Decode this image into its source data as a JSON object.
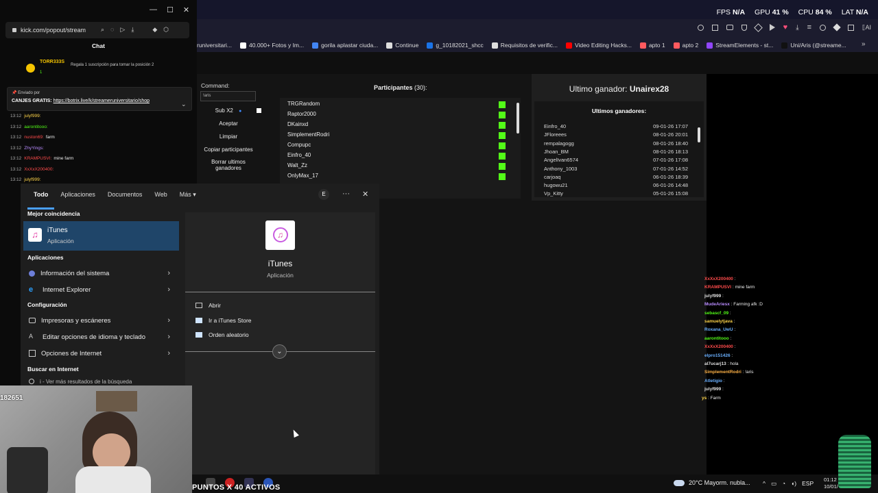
{
  "perf": {
    "fps_label": "FPS",
    "fps": "N/A",
    "gpu_label": "GPU",
    "gpu": "41 %",
    "cpu_label": "CPU",
    "cpu": "84 %",
    "lat_label": "LAT",
    "lat": "N/A"
  },
  "chat_window": {
    "url": "kick.com/popout/stream",
    "title": "Chat",
    "top_user": "TORR333S",
    "top_user_count": "1",
    "sub_prompt": "Regala 1 suscripción para tomar la posición 2",
    "pinned_by": "Enviado por",
    "pinned_text_prefix": "CANJES GRATIS:",
    "pinned_link": "https://botrix.live/k/streameruniversitario/shop"
  },
  "chat_lines": [
    {
      "time": "13:12",
      "user": "julyf999:",
      "msg": ""
    },
    {
      "time": "13:12",
      "user": "aarontitooo:",
      "msg": ""
    },
    {
      "time": "13:12",
      "user": "nuston69:",
      "msg": "farm"
    },
    {
      "time": "13:12",
      "user": "ZhyYings:",
      "msg": ""
    },
    {
      "time": "13:12",
      "user": "KRAMPUSVI:",
      "msg": "mine farm"
    },
    {
      "time": "13:12",
      "user": "XxXxX200400:",
      "msg": ""
    },
    {
      "time": "13:12",
      "user": "julyf999:",
      "msg": ""
    }
  ],
  "bookmarks": [
    {
      "label": "runiversitari...",
      "color": "#444"
    },
    {
      "label": "40.000+ Fotos y Im...",
      "color": "#ffffff"
    },
    {
      "label": "gorila aplastar ciuda...",
      "color": "#4285f4"
    },
    {
      "label": "Continue",
      "color": "#dddddd"
    },
    {
      "label": "g_10182021_shcc",
      "color": "#1a73e8"
    },
    {
      "label": "Requisitos de verific...",
      "color": "#dddddd"
    },
    {
      "label": "Video Editing Hacks...",
      "color": "#ff0000"
    },
    {
      "label": "apto 1",
      "color": "#ff5a5f"
    },
    {
      "label": "apto 2",
      "color": "#ff5a5f"
    },
    {
      "label": "StreamElements - st...",
      "color": "#9146ff"
    },
    {
      "label": "Uni/Aris (@streame...",
      "color": "#111111"
    }
  ],
  "giveaway": {
    "command_label": "Command:",
    "command_value": "!aris",
    "sub_label": "Sub X2",
    "accept": "Aceptar",
    "clear": "Limpiar",
    "copy": "Copiar participantes",
    "delete": "Borrar ultimos ganadores",
    "participants_label": "Participantes",
    "participants_count": "(30):",
    "participants": [
      "TRGRandom",
      "Raptor2000",
      "DKainxd",
      "SimplementRodri",
      "Compupc",
      "Einfro_40",
      "Walt_Zz",
      "OnlyMax_17"
    ],
    "last_winner_label": "Ultimo ganador:",
    "last_winner": "Unairex28",
    "winners_title": "Ultimos ganadores:",
    "winners": [
      {
        "name": "Einfro_40",
        "date": "09-01-26 17:07"
      },
      {
        "name": "JFloreees",
        "date": "08-01-26 20:01"
      },
      {
        "name": "rempalagogg",
        "date": "08-01-26 18:40"
      },
      {
        "name": "Jhoan_BM",
        "date": "08-01-26 18:13"
      },
      {
        "name": "AngelIvan6574",
        "date": "07-01-26 17:08"
      },
      {
        "name": "Anthony_1003",
        "date": "07-01-26 14:52"
      },
      {
        "name": "carjoaq",
        "date": "06-01-26 18:39"
      },
      {
        "name": "hugowu21",
        "date": "06-01-26 14:48"
      },
      {
        "name": "Vp_Kitty",
        "date": "05-01-26 15:08"
      }
    ]
  },
  "right_chat": [
    {
      "user": "XxXxX200400",
      "msg": "",
      "color": "#ff4b4b"
    },
    {
      "user": "KRAMPUSVI",
      "msg": "mine farm",
      "color": "#ff4b4b"
    },
    {
      "user": "julyf999",
      "msg": "",
      "color": "#e0e0e0"
    },
    {
      "user": "MudeAriesx",
      "msg": "Farming afk :D",
      "color": "#b98cff"
    },
    {
      "user": "sebascf_09",
      "msg": "",
      "color": "#53fc18"
    },
    {
      "user": "samuelytjava",
      "msg": "",
      "color": "#ffd54a"
    },
    {
      "user": "Roxana_UwU",
      "msg": "",
      "color": "#6ab0ff"
    },
    {
      "user": "aarontitooo",
      "msg": "",
      "color": "#53fc18"
    },
    {
      "user": "XxXxX200400",
      "msg": "",
      "color": "#ff4b4b"
    },
    {
      "user": "elpro151426",
      "msg": "",
      "color": "#6ab0ff"
    },
    {
      "user": "al7ucarj13",
      "msg": "hola",
      "color": "#e0e0e0"
    },
    {
      "user": "SimplementRodri",
      "msg": "!aris",
      "color": "#ffb347"
    },
    {
      "user": "Atletigio",
      "msg": "",
      "color": "#6ab0ff"
    },
    {
      "user": "julyf999",
      "msg": "",
      "color": "#e0e0e0"
    },
    {
      "user": "ys",
      "msg": "Farm",
      "color": "#ffd54a"
    }
  ],
  "search": {
    "tabs": [
      "Todo",
      "Aplicaciones",
      "Documentos",
      "Web",
      "Más"
    ],
    "user_initial": "E",
    "best_match_label": "Mejor coincidencia",
    "best_name": "iTunes",
    "best_type": "Aplicación",
    "apps_label": "Aplicaciones",
    "apps": [
      "Información del sistema",
      "Internet Explorer"
    ],
    "settings_label": "Configuración",
    "settings": [
      "Impresoras y escáneres",
      "Editar opciones de idioma y teclado",
      "Opciones de Internet"
    ],
    "web_label": "Buscar en Internet",
    "web_item": "i - Ver más resultados de la búsqueda",
    "detail_name": "iTunes",
    "detail_type": "Aplicación",
    "actions": [
      "Abrir",
      "Ir a iTunes Store",
      "Orden aleatorio"
    ]
  },
  "webcam": {
    "overlay_text": "182651"
  },
  "taskbar": {
    "banner": "PUNTOS X 40 ACTIVOS",
    "weather": "20°C  Mayorm. nubla...",
    "lang": "ESP",
    "time": "01:12",
    "date": "10/01/"
  },
  "colors": {
    "accent": "#4aa0ff",
    "kick_green": "#53fc18",
    "best_match_bg": "#1f4569"
  }
}
